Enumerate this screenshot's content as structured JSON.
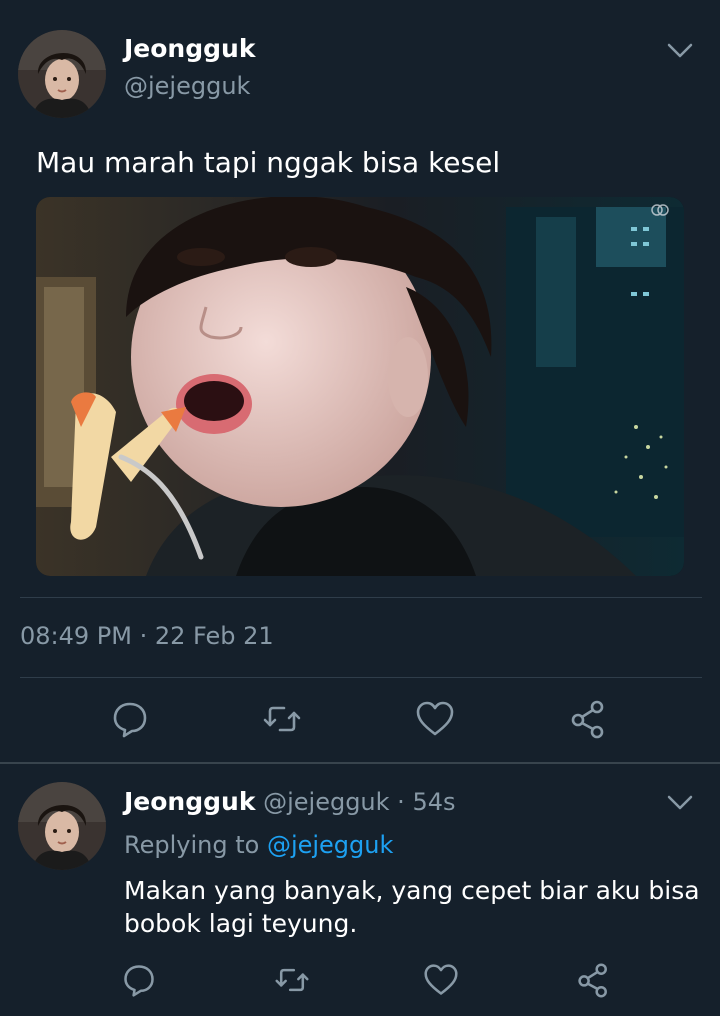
{
  "main_tweet": {
    "author_name": "Jeongguk",
    "author_handle": "@jejegguk",
    "text": "Mau marah tapi nggak bisa kesel",
    "timestamp": "08:49 PM · 22 Feb 21",
    "avatar_icon": "profile-photo",
    "media_icon": "photo-person-eating-fries",
    "more_icon": "chevron-down-icon"
  },
  "actions": {
    "reply_icon": "reply-icon",
    "retweet_icon": "retweet-icon",
    "like_icon": "heart-icon",
    "share_icon": "share-icon"
  },
  "reply_tweet": {
    "author_name": "Jeongguk",
    "author_handle": "@jejegguk",
    "separator": " · ",
    "time_ago": "54s",
    "replying_prefix": "Replying to ",
    "replying_to": "@jejegguk",
    "text": "Makan yang banyak, yang cepet biar aku bisa bobok lagi teyung."
  },
  "colors": {
    "background": "#15202b",
    "primary_text": "#ffffff",
    "secondary_text": "#8899a6",
    "accent": "#1da1f2",
    "divider": "#38444d"
  }
}
